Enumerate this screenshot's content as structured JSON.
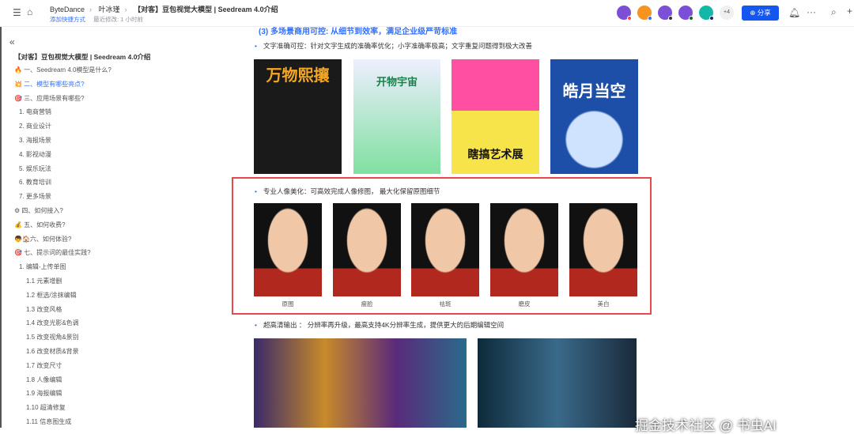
{
  "header": {
    "breadcrumb": [
      "ByteDance",
      "叶冰瑾",
      "【对客】豆包视觉大模型 | Seedream 4.0介绍"
    ],
    "add_shortcut": "添加快捷方式",
    "last_modified": "最近修改: 1 小时前",
    "more_count": "+4",
    "share": "分享"
  },
  "colors": {
    "accent": "#3370ff",
    "share": "#1456f0",
    "highlight_box": "#e5484d"
  },
  "sidebar": {
    "title": "【对客】豆包视觉大模型 | Seedream 4.0介绍",
    "items": [
      {
        "label": "🔥 一、Seedream 4.0模型是什么?",
        "level": 1
      },
      {
        "label": "💥 二、模型有哪些亮点?",
        "level": 1,
        "active": true
      },
      {
        "label": "🎯 三、应用场景有哪些?",
        "level": 1
      },
      {
        "label": "1. 电商营销",
        "level": 2
      },
      {
        "label": "2. 商业设计",
        "level": 2
      },
      {
        "label": "3. 海报场景",
        "level": 2
      },
      {
        "label": "4. 影视动漫",
        "level": 2
      },
      {
        "label": "5. 娱乐玩法",
        "level": 2
      },
      {
        "label": "6. 教育培训",
        "level": 2
      },
      {
        "label": "7. 更多场景",
        "level": 2
      },
      {
        "label": "⚙ 四、如何接入?",
        "level": 1
      },
      {
        "label": "💰 五、如何收费?",
        "level": 1
      },
      {
        "label": "👦🏠六、如何体验?",
        "level": 1
      },
      {
        "label": "🎯 七、提示词的最佳实践?",
        "level": 1
      },
      {
        "label": "1. 编辑-上传单图",
        "level": 2
      },
      {
        "label": "1.1 元素增删",
        "level": 3
      },
      {
        "label": "1.2 框选/涂抹编辑",
        "level": 3
      },
      {
        "label": "1.3 改变风格",
        "level": 3
      },
      {
        "label": "1.4 改变光影&色调",
        "level": 3
      },
      {
        "label": "1.5 改变视角&景别",
        "level": 3
      },
      {
        "label": "1.6 改变材质&背景",
        "level": 3
      },
      {
        "label": "1.7 改变尺寸",
        "level": 3
      },
      {
        "label": "1.8 人像编辑",
        "level": 3
      },
      {
        "label": "1.9 海报编辑",
        "level": 3
      },
      {
        "label": "1.10 超清修复",
        "level": 3
      },
      {
        "label": "1.11 信息图生成",
        "level": 3
      }
    ]
  },
  "content": {
    "heading": "(3) 多场景商用可控: 从细节到效率，满足企业级严苛标准",
    "bullet1": "文字准确可控：针对文字生成的准确率优化；小字准确率极高；文字重复问题得到极大改善",
    "posters": [
      "万物熙攘",
      "开物宇宙",
      "瞎搞艺术展",
      "皓月当空"
    ],
    "bullet2": "专业人像美化：可高效完成人像修图， 最大化保留原图细节",
    "portraits": [
      "原图",
      "瘦脸",
      "祛斑",
      "磨皮",
      "美白"
    ],
    "bullet3": "超高清输出 ： 分辨率再升级，最高支持4K分辨率生成，提供更大的后期编辑空间"
  },
  "watermark": "掘金技术社区 @ 书虫AI"
}
